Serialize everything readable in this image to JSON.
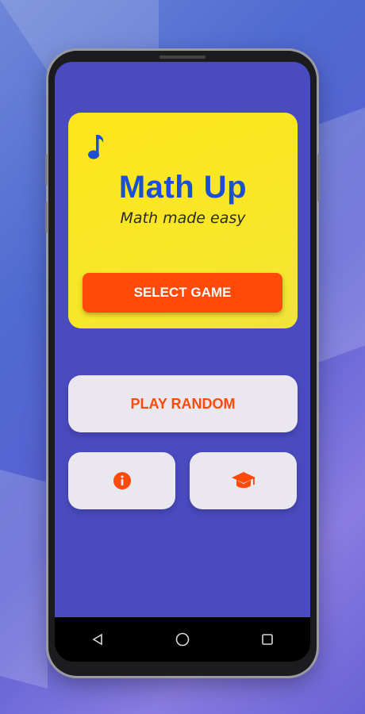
{
  "app": {
    "title": "Math Up",
    "subtitle": "Math made easy"
  },
  "buttons": {
    "select_game": "SELECT GAME",
    "play_random": "PLAY RANDOM"
  },
  "icons": {
    "music": "music-note-icon",
    "info": "info-icon",
    "learn": "graduation-cap-icon",
    "nav_back": "back-triangle-icon",
    "nav_home": "home-circle-icon",
    "nav_recent": "recent-square-icon"
  },
  "colors": {
    "screen_bg": "#4a4bc0",
    "hero_bg": "#ffe51a",
    "title": "#1a4fd6",
    "accent": "#ff4a0a",
    "card_bg": "#ebe7ee"
  }
}
